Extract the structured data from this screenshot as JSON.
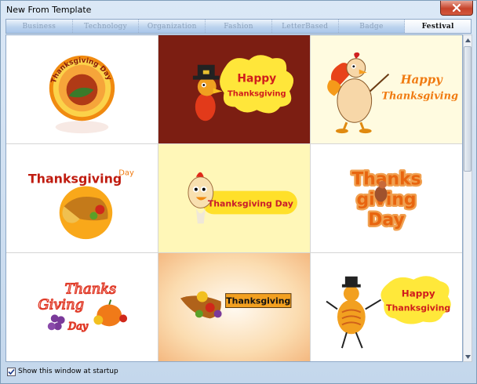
{
  "window": {
    "title": "New From Template"
  },
  "tabs": [
    {
      "label": "Business",
      "active": false
    },
    {
      "label": "Technology",
      "active": false
    },
    {
      "label": "Organization",
      "active": false
    },
    {
      "label": "Fashion",
      "active": false
    },
    {
      "label": "LetterBased",
      "active": false
    },
    {
      "label": "Badge",
      "active": false
    },
    {
      "label": "Festival",
      "active": true
    }
  ],
  "templates": [
    {
      "text_a": "Thanksgiving Day",
      "text_b": ""
    },
    {
      "text_a": "Happy",
      "text_b": "Thanksgiving"
    },
    {
      "text_a": "Happy",
      "text_b": "Thanksgiving"
    },
    {
      "text_a": "Thanksgiving",
      "text_b": "Day"
    },
    {
      "text_a": "Thanksgiving Day",
      "text_b": ""
    },
    {
      "text_a": "Thanks",
      "text_b": "giving",
      "text_c": "Day"
    },
    {
      "text_a": "Thanks",
      "text_b": "Giving",
      "text_c": "Day"
    },
    {
      "text_a": "Thanksgiving",
      "text_b": ""
    },
    {
      "text_a": "Happy",
      "text_b": "Thanksgiving"
    }
  ],
  "footer": {
    "startup_label": "Show this window at startup",
    "startup_checked": true
  },
  "colors": {
    "accent_orange": "#f07a10",
    "dark_red": "#7c1e12",
    "cream": "#fffbe0"
  }
}
